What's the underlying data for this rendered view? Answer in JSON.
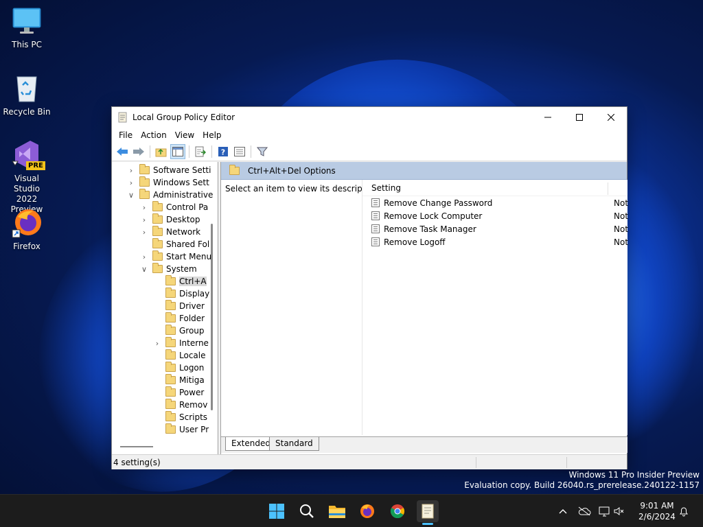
{
  "desktop": {
    "icons": [
      {
        "label": "This PC"
      },
      {
        "label": "Recycle Bin"
      },
      {
        "label_line1": "Visual Studio",
        "label_line2": "2022 Preview",
        "badge": "PRE"
      },
      {
        "label": "Firefox"
      }
    ]
  },
  "window": {
    "title": "Local Group Policy Editor",
    "menu": [
      "File",
      "Action",
      "View",
      "Help"
    ],
    "tree": [
      {
        "label": "Software Setti",
        "chev": ">"
      },
      {
        "label": "Windows Sett",
        "chev": ">"
      },
      {
        "label": "Administrative",
        "chev": "v"
      },
      {
        "label": "Control Pa",
        "chev": ">"
      },
      {
        "label": "Desktop",
        "chev": ">"
      },
      {
        "label": "Network",
        "chev": ">"
      },
      {
        "label": "Shared Fol",
        "chev": ""
      },
      {
        "label": "Start Menu",
        "chev": ">"
      },
      {
        "label": "System",
        "chev": "v"
      },
      {
        "label": "Ctrl+A",
        "chev": ""
      },
      {
        "label": "Display",
        "chev": ""
      },
      {
        "label": "Driver",
        "chev": ""
      },
      {
        "label": "Folder",
        "chev": ""
      },
      {
        "label": "Group",
        "chev": ""
      },
      {
        "label": "Interne",
        "chev": ">"
      },
      {
        "label": "Locale",
        "chev": ""
      },
      {
        "label": "Logon",
        "chev": ""
      },
      {
        "label": "Mitiga",
        "chev": ""
      },
      {
        "label": "Power",
        "chev": ""
      },
      {
        "label": "Remov",
        "chev": ""
      },
      {
        "label": "Scripts",
        "chev": ""
      },
      {
        "label": "User Pr",
        "chev": ""
      }
    ],
    "right_header": "Ctrl+Alt+Del Options",
    "description": "Select an item to view its description.",
    "list_header": "Setting",
    "settings": [
      {
        "name": "Remove Change Password",
        "state": "Not"
      },
      {
        "name": "Remove Lock Computer",
        "state": "Not"
      },
      {
        "name": "Remove Task Manager",
        "state": "Not"
      },
      {
        "name": "Remove Logoff",
        "state": "Not"
      }
    ],
    "tabs": [
      "Extended",
      "Standard"
    ],
    "status": "4 setting(s)"
  },
  "watermark": {
    "line1": "Windows 11 Pro Insider Preview",
    "line2": "Evaluation copy. Build 26040.rs_prerelease.240122-1157"
  },
  "taskbar": {
    "time": "9:01 AM",
    "date": "2/6/2024"
  },
  "colors": {
    "accent": "#4cc2ff",
    "header_blue": "#b9cbe3",
    "folder": "#f5d67a"
  }
}
